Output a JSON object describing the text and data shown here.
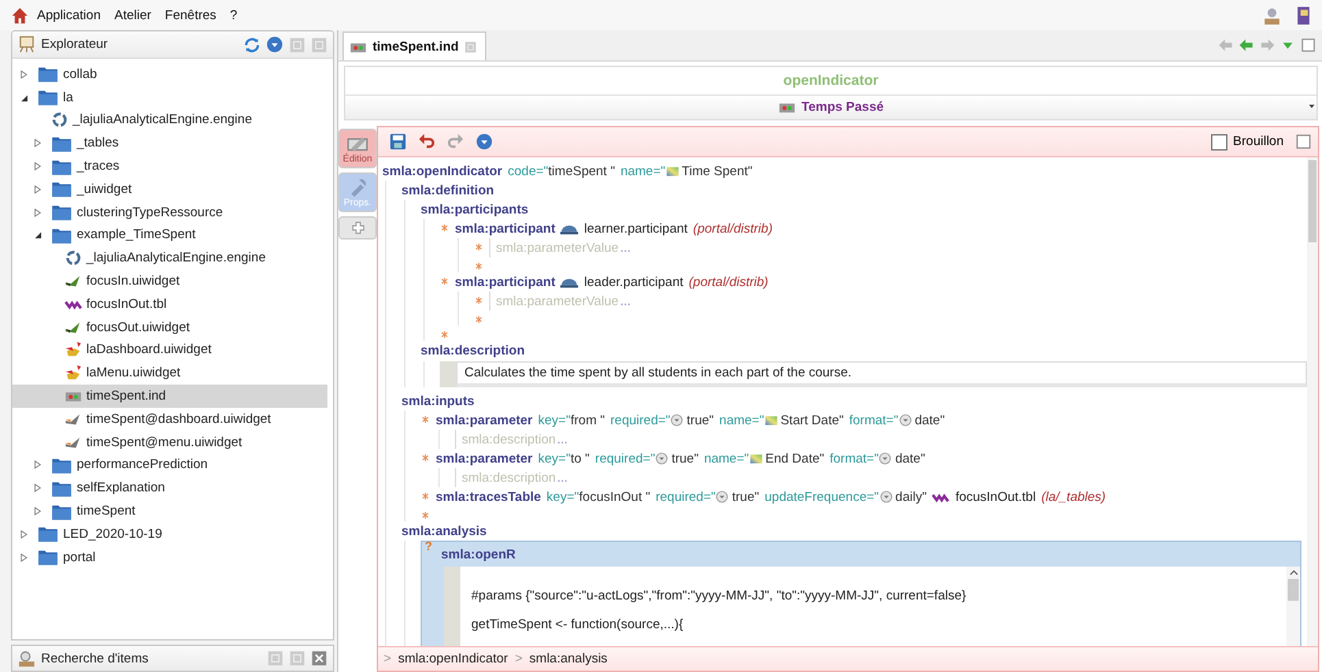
{
  "menu": [
    {
      "label": "Application"
    },
    {
      "label": "Atelier"
    },
    {
      "label": "Fenêtres"
    },
    {
      "label": "?"
    }
  ],
  "explorer": {
    "title": "Explorateur",
    "tree": [
      {
        "label": "collab",
        "kind": "folder",
        "expanded": false,
        "selected": false
      },
      {
        "label": "la",
        "kind": "folder",
        "expanded": true,
        "selected": false,
        "children": [
          {
            "label": "_lajuliaAnalyticalEngine.engine",
            "kind": "engine",
            "selected": false
          },
          {
            "label": "_tables",
            "kind": "folder",
            "expanded": false,
            "selected": false
          },
          {
            "label": "_traces",
            "kind": "folder",
            "expanded": false,
            "selected": false
          },
          {
            "label": "_uiwidget",
            "kind": "folder",
            "expanded": false,
            "selected": false
          },
          {
            "label": "clusteringTypeRessource",
            "kind": "folder",
            "expanded": false,
            "selected": false
          },
          {
            "label": "example_TimeSpent",
            "kind": "folder",
            "expanded": true,
            "selected": false,
            "children": [
              {
                "label": "_lajuliaAnalyticalEngine.engine",
                "kind": "engine",
                "selected": false
              },
              {
                "label": "focusIn.uiwidget",
                "kind": "widget",
                "selected": false
              },
              {
                "label": "focusInOut.tbl",
                "kind": "table",
                "selected": false
              },
              {
                "label": "focusOut.uiwidget",
                "kind": "widget",
                "selected": false
              },
              {
                "label": "laDashboard.uiwidget",
                "kind": "dashboard",
                "selected": false
              },
              {
                "label": "laMenu.uiwidget",
                "kind": "dashboard",
                "selected": false
              },
              {
                "label": "timeSpent.ind",
                "kind": "indicator",
                "selected": true
              },
              {
                "label": "timeSpent@dashboard.uiwidget",
                "kind": "view",
                "selected": false
              },
              {
                "label": "timeSpent@menu.uiwidget",
                "kind": "view",
                "selected": false
              }
            ]
          },
          {
            "label": "performancePrediction",
            "kind": "folder",
            "expanded": false,
            "selected": false
          },
          {
            "label": "selfExplanation",
            "kind": "folder",
            "expanded": false,
            "selected": false
          },
          {
            "label": "timeSpent",
            "kind": "folder",
            "expanded": false,
            "selected": false
          }
        ]
      },
      {
        "label": "LED_2020-10-19",
        "kind": "folder",
        "expanded": false,
        "selected": false
      },
      {
        "label": "portal",
        "kind": "folder",
        "expanded": false,
        "selected": false
      }
    ]
  },
  "search_panel": {
    "title": "Recherche d'items"
  },
  "editor": {
    "tabs": [
      {
        "label": "timeSpent.ind",
        "selected": true
      }
    ],
    "header": {
      "title": "openIndicator",
      "subtitle": "Temps Passé"
    },
    "side_tabs": [
      {
        "kind": "edit",
        "label": "Édition",
        "selected": true
      },
      {
        "kind": "props",
        "label": "Props.",
        "selected": false
      },
      {
        "kind": "add",
        "selected": false
      }
    ],
    "draft": {
      "label": "Brouillon",
      "checked": false
    },
    "document": {
      "kind": "element",
      "tag": "smla:openIndicator",
      "selected": false,
      "attrs": [
        {
          "name": "code=\"",
          "value": "timeSpent \""
        },
        {
          "name": "name=\"",
          "value": "Time Spent\"",
          "kind": "label"
        }
      ],
      "children": [
        {
          "kind": "element",
          "tag": "smla:definition",
          "selected": false,
          "children": [
            {
              "kind": "element",
              "tag": "smla:participants",
              "selected": false,
              "insert_points": true,
              "children": [
                {
                  "kind": "element",
                  "tag": "smla:participant",
                  "selected": false,
                  "insert_points": true,
                  "ref": {
                    "kind": "participant",
                    "name": "learner.participant",
                    "path": "(portal/distrib)"
                  },
                  "children": [
                    {
                      "kind": "placeholder",
                      "tag": "smla:parameterValue"
                    }
                  ]
                },
                {
                  "kind": "element",
                  "tag": "smla:participant",
                  "selected": false,
                  "insert_points": true,
                  "ref": {
                    "kind": "participant",
                    "name": "leader.participant",
                    "path": "(portal/distrib)"
                  },
                  "children": [
                    {
                      "kind": "placeholder",
                      "tag": "smla:parameterValue"
                    }
                  ]
                }
              ]
            },
            {
              "kind": "element",
              "tag": "smla:description",
              "selected": false,
              "children": [
                {
                  "kind": "text",
                  "text": "Calculates the time spent by all students in each part of the course."
                }
              ]
            }
          ]
        },
        {
          "kind": "element",
          "tag": "smla:inputs",
          "selected": false,
          "insert_points": true,
          "children": [
            {
              "kind": "element",
              "tag": "smla:parameter",
              "selected": false,
              "attrs": [
                {
                  "name": "key=\"",
                  "value": "from \""
                },
                {
                  "name": "required=\"",
                  "value": "true\"",
                  "kind": "choice"
                },
                {
                  "name": "name=\"",
                  "value": "Start Date\"",
                  "kind": "label"
                },
                {
                  "name": "format=\"",
                  "value": "date\"",
                  "kind": "choice"
                }
              ],
              "children": [
                {
                  "kind": "placeholder",
                  "tag": "smla:description"
                }
              ]
            },
            {
              "kind": "element",
              "tag": "smla:parameter",
              "selected": false,
              "attrs": [
                {
                  "name": "key=\"",
                  "value": "to \""
                },
                {
                  "name": "required=\"",
                  "value": "true\"",
                  "kind": "choice"
                },
                {
                  "name": "name=\"",
                  "value": "End Date\"",
                  "kind": "label"
                },
                {
                  "name": "format=\"",
                  "value": "date\"",
                  "kind": "choice"
                }
              ],
              "children": [
                {
                  "kind": "placeholder",
                  "tag": "smla:description"
                }
              ]
            },
            {
              "kind": "element",
              "tag": "smla:tracesTable",
              "selected": false,
              "attrs": [
                {
                  "name": "key=\"",
                  "value": "focusInOut \""
                },
                {
                  "name": "required=\"",
                  "value": "true\"",
                  "kind": "choice"
                },
                {
                  "name": "updateFrequence=\"",
                  "value": "daily\"",
                  "kind": "choice"
                }
              ],
              "ref": {
                "kind": "table",
                "name": "focusInOut.tbl",
                "path": "(la/_tables)"
              }
            }
          ]
        },
        {
          "kind": "element",
          "tag": "smla:analysis",
          "selected": false,
          "children": [
            {
              "kind": "element",
              "tag": "smla:openR",
              "selected": true,
              "hint": "?",
              "children": [
                {
                  "kind": "code",
                  "lines": [
                    "#params {\"source\":\"u-actLogs\",\"from\":\"yyyy-MM-JJ\", \"to\":\"yyyy-MM-JJ\", current=false}",
                    "getTimeSpent <- function(source,...){"
                  ]
                }
              ]
            }
          ]
        }
      ]
    },
    "breadcrumb": {
      "separator": ">",
      "items": [
        {
          "label": "smla:openIndicator"
        },
        {
          "label": "smla:analysis"
        }
      ]
    }
  }
}
